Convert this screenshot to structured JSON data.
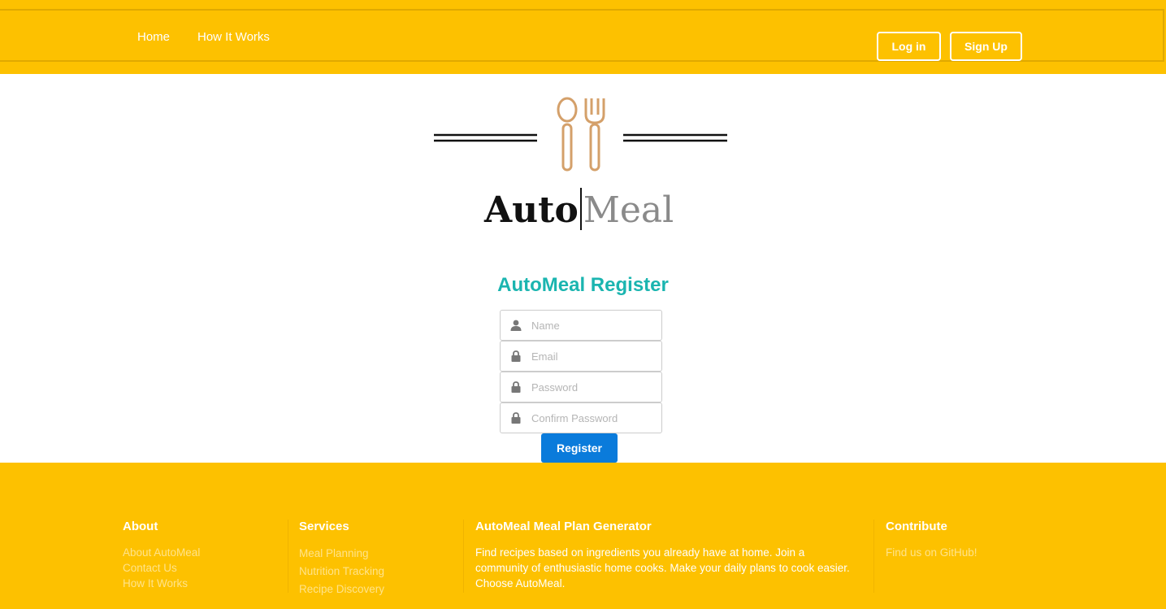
{
  "nav": {
    "home": "Home",
    "how_it_works": "How It Works",
    "login": "Log in",
    "signup": "Sign Up"
  },
  "logo": {
    "part1": "Auto",
    "part2": "Meal"
  },
  "form": {
    "title": "AutoMeal Register",
    "name_placeholder": "Name",
    "email_placeholder": "Email",
    "password_placeholder": "Password",
    "confirm_placeholder": "Confirm Password",
    "register": "Register"
  },
  "footer": {
    "about": {
      "heading": "About",
      "links": [
        "About AutoMeal",
        "Contact Us",
        "How It Works"
      ]
    },
    "services": {
      "heading": "Services",
      "links": [
        "Meal Planning",
        "Nutrition Tracking",
        "Recipe Discovery"
      ]
    },
    "generator": {
      "heading": "AutoMeal Meal Plan Generator",
      "text": "Find recipes based on ingredients you already have at home. Join a community of enthusiastic home cooks. Make your daily plans to cook easier. Choose AutoMeal."
    },
    "contribute": {
      "heading": "Contribute",
      "link": "Find us on GitHub!"
    }
  },
  "colors": {
    "brand_yellow": "#FDC100",
    "title_teal": "#1BB5B0",
    "button_blue": "#0A7BDB",
    "logo_copper": "#D4A06A"
  },
  "icons": {
    "name": "user-icon",
    "email": "lock-icon",
    "password": "lock-icon",
    "confirm": "lock-icon"
  }
}
